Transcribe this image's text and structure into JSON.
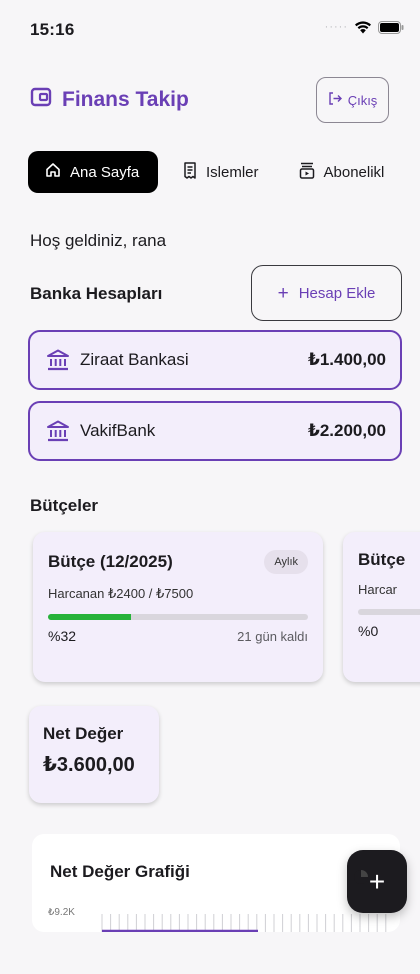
{
  "status_bar": {
    "time": "15:16",
    "signal_icon": "signal-dots",
    "wifi_icon": "wifi-icon",
    "battery_icon": "battery-icon"
  },
  "header": {
    "title": "Finans Takip",
    "logo_icon": "wallet-icon",
    "logout_label": "Çıkış",
    "logout_icon": "logout-icon"
  },
  "tabs": [
    {
      "label": "Ana Sayfa",
      "icon": "home-icon",
      "active": true
    },
    {
      "label": "Islemler",
      "icon": "receipt-icon",
      "active": false
    },
    {
      "label": "Abonelikl",
      "icon": "subscriptions-icon",
      "active": false
    }
  ],
  "greeting": "Hoş geldiniz, rana",
  "accounts_section": {
    "title": "Banka Hesapları",
    "add_label": "Hesap Ekle",
    "items": [
      {
        "name": "Ziraat Bankasi",
        "balance": "₺1.400,00",
        "icon": "bank-icon"
      },
      {
        "name": "VakifBank",
        "balance": "₺2.200,00",
        "icon": "bank-icon"
      }
    ]
  },
  "budgets_section": {
    "title": "Bütçeler",
    "items": [
      {
        "name": "Bütçe (12/2025)",
        "period": "Aylık",
        "spent": "Harcanan ₺2400 / ₺7500",
        "percent_label": "%32",
        "progress": 0.32,
        "days_left": "21 gün kaldı"
      },
      {
        "name": "Bütçe",
        "spent": "Harcar",
        "percent_label": "%0",
        "progress": 0
      }
    ]
  },
  "net_worth": {
    "label": "Net Değer",
    "value": "₺3.600,00"
  },
  "chart_card": {
    "title": "Net Değer Grafiği",
    "tick_label": "₺9.2K"
  },
  "fab": {
    "label": "+",
    "icon": "plus-icon"
  },
  "colors": {
    "accent": "#6a3fb5",
    "progress": "#27b23a",
    "card_bg": "#f3eefb",
    "active_tab": "#000000"
  }
}
